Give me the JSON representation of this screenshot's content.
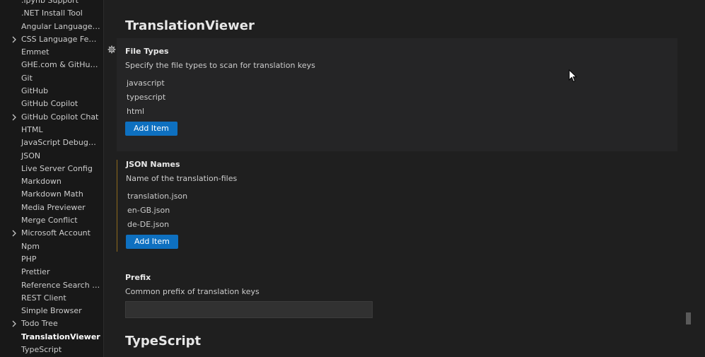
{
  "sidebar": {
    "items": [
      {
        "label": ".ipynb Support",
        "expandable": false,
        "active": false
      },
      {
        "label": ".NET Install Tool",
        "expandable": false,
        "active": false
      },
      {
        "label": "Angular Language Ser...",
        "expandable": false,
        "active": false
      },
      {
        "label": "CSS Language Features",
        "expandable": true,
        "active": false
      },
      {
        "label": "Emmet",
        "expandable": false,
        "active": false
      },
      {
        "label": "GHE.com & GitHub En...",
        "expandable": false,
        "active": false
      },
      {
        "label": "Git",
        "expandable": false,
        "active": false
      },
      {
        "label": "GitHub",
        "expandable": false,
        "active": false
      },
      {
        "label": "GitHub Copilot",
        "expandable": false,
        "active": false
      },
      {
        "label": "GitHub Copilot Chat",
        "expandable": true,
        "active": false
      },
      {
        "label": "HTML",
        "expandable": false,
        "active": false
      },
      {
        "label": "JavaScript Debugger",
        "expandable": false,
        "active": false
      },
      {
        "label": "JSON",
        "expandable": false,
        "active": false
      },
      {
        "label": "Live Server Config",
        "expandable": false,
        "active": false
      },
      {
        "label": "Markdown",
        "expandable": false,
        "active": false
      },
      {
        "label": "Markdown Math",
        "expandable": false,
        "active": false
      },
      {
        "label": "Media Previewer",
        "expandable": false,
        "active": false
      },
      {
        "label": "Merge Conflict",
        "expandable": false,
        "active": false
      },
      {
        "label": "Microsoft Account",
        "expandable": true,
        "active": false
      },
      {
        "label": "Npm",
        "expandable": false,
        "active": false
      },
      {
        "label": "PHP",
        "expandable": false,
        "active": false
      },
      {
        "label": "Prettier",
        "expandable": false,
        "active": false
      },
      {
        "label": "Reference Search View",
        "expandable": false,
        "active": false
      },
      {
        "label": "REST Client",
        "expandable": false,
        "active": false
      },
      {
        "label": "Simple Browser",
        "expandable": false,
        "active": false
      },
      {
        "label": "Todo Tree",
        "expandable": true,
        "active": false
      },
      {
        "label": "TranslationViewer",
        "expandable": false,
        "active": true
      },
      {
        "label": "TypeScript",
        "expandable": false,
        "active": false
      }
    ]
  },
  "main": {
    "section_title": "TranslationViewer",
    "next_section_title": "TypeScript",
    "file_types": {
      "title": "File Types",
      "description": "Specify the file types to scan for translation keys",
      "items": [
        "javascript",
        "typescript",
        "html"
      ],
      "add_label": "Add Item"
    },
    "json_names": {
      "title": "JSON Names",
      "description": "Name of the translation-files",
      "items": [
        "translation.json",
        "en-GB.json",
        "de-DE.json"
      ],
      "add_label": "Add Item"
    },
    "prefix": {
      "title": "Prefix",
      "description": "Common prefix of translation keys",
      "value": ""
    }
  },
  "colors": {
    "button": "#0e70c0",
    "modified_indicator": "#8f6a1c",
    "highlight_background": "#252526"
  }
}
